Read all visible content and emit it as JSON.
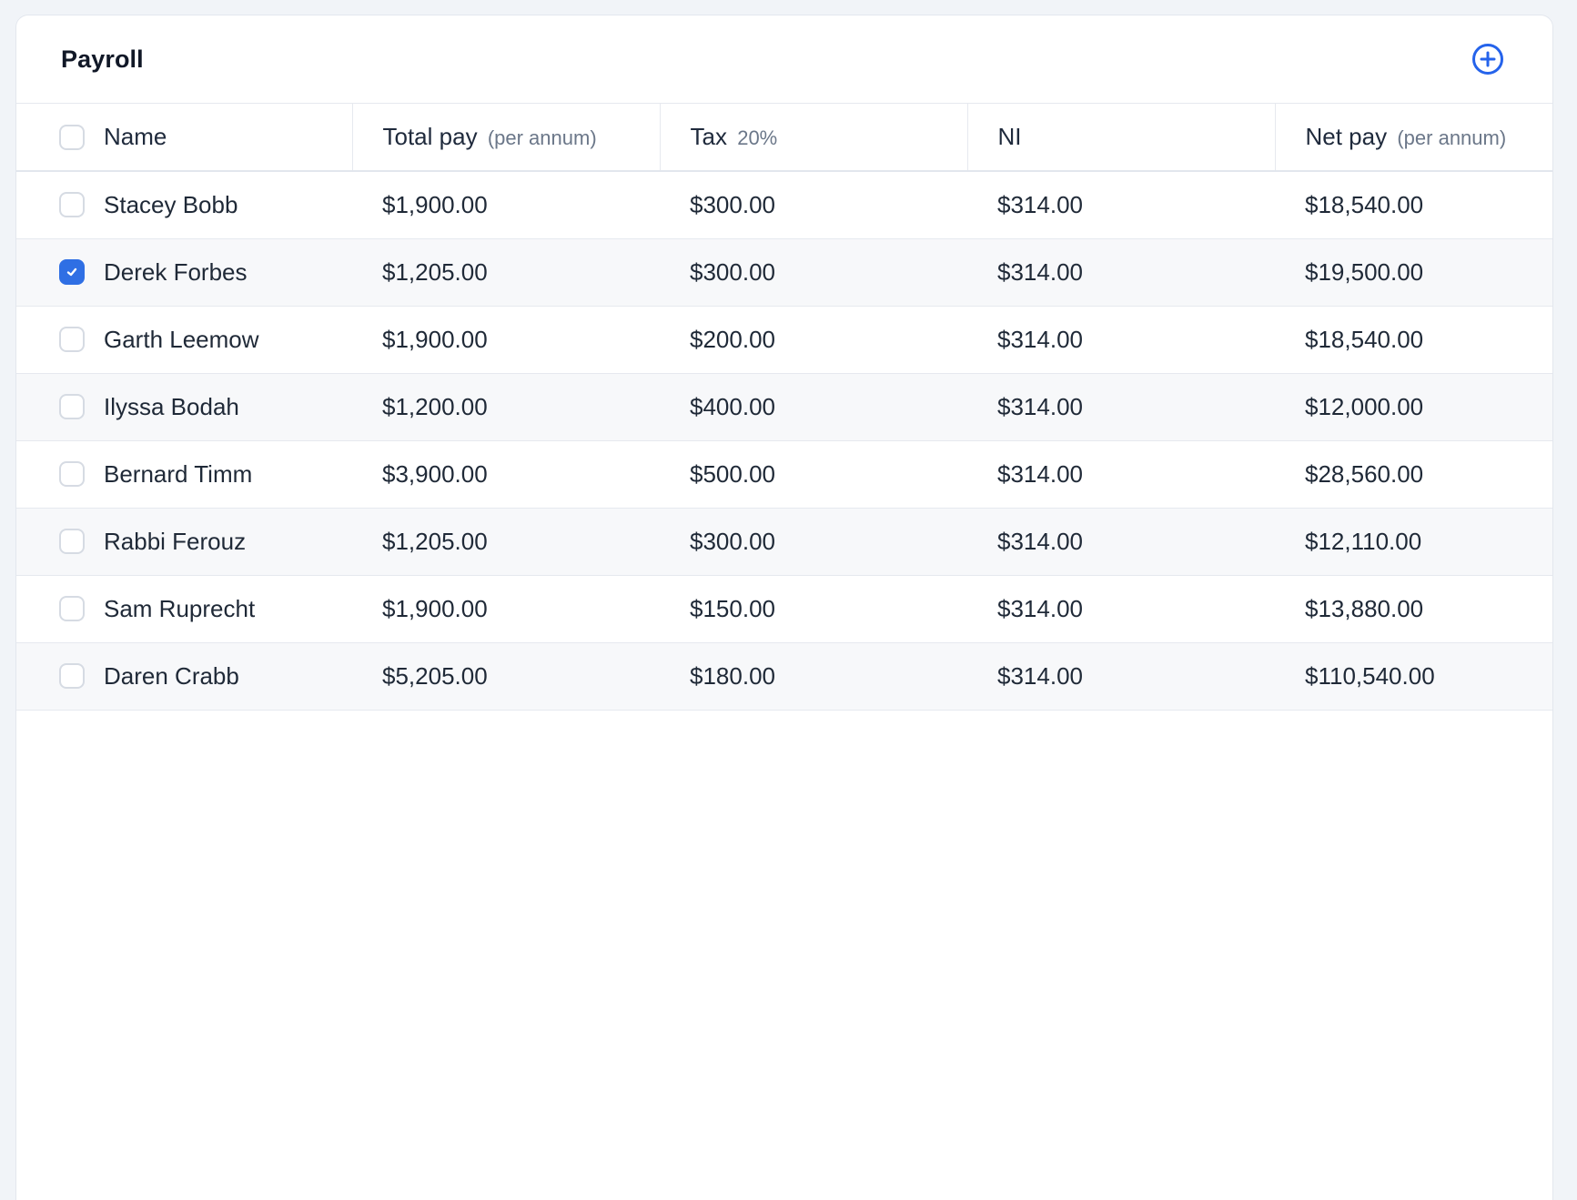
{
  "header": {
    "title": "Payroll",
    "add_icon": "plus-circle-icon",
    "accent_color": "#2563eb"
  },
  "columns": [
    {
      "label": "Name",
      "sub": ""
    },
    {
      "label": "Total pay",
      "sub": "(per annum)"
    },
    {
      "label": "Tax",
      "sub": "20%"
    },
    {
      "label": "NI",
      "sub": ""
    },
    {
      "label": "Net pay",
      "sub": "(per annum)"
    }
  ],
  "select_all_checked": false,
  "rows": [
    {
      "name": "Stacey Bobb",
      "total_pay": "$1,900.00",
      "tax": "$300.00",
      "ni": "$314.00",
      "net_pay": "$18,540.00",
      "checked": false
    },
    {
      "name": "Derek Forbes",
      "total_pay": "$1,205.00",
      "tax": "$300.00",
      "ni": "$314.00",
      "net_pay": "$19,500.00",
      "checked": true
    },
    {
      "name": "Garth Leemow",
      "total_pay": "$1,900.00",
      "tax": "$200.00",
      "ni": "$314.00",
      "net_pay": "$18,540.00",
      "checked": false
    },
    {
      "name": "Ilyssa Bodah",
      "total_pay": "$1,200.00",
      "tax": "$400.00",
      "ni": "$314.00",
      "net_pay": "$12,000.00",
      "checked": false
    },
    {
      "name": "Bernard Timm",
      "total_pay": "$3,900.00",
      "tax": "$500.00",
      "ni": "$314.00",
      "net_pay": "$28,560.00",
      "checked": false
    },
    {
      "name": "Rabbi Ferouz",
      "total_pay": "$1,205.00",
      "tax": "$300.00",
      "ni": "$314.00",
      "net_pay": "$12,110.00",
      "checked": false
    },
    {
      "name": "Sam Ruprecht",
      "total_pay": "$1,900.00",
      "tax": "$150.00",
      "ni": "$314.00",
      "net_pay": "$13,880.00",
      "checked": false
    },
    {
      "name": "Daren Crabb",
      "total_pay": "$5,205.00",
      "tax": "$180.00",
      "ni": "$314.00",
      "net_pay": "$110,540.00",
      "checked": false
    }
  ]
}
